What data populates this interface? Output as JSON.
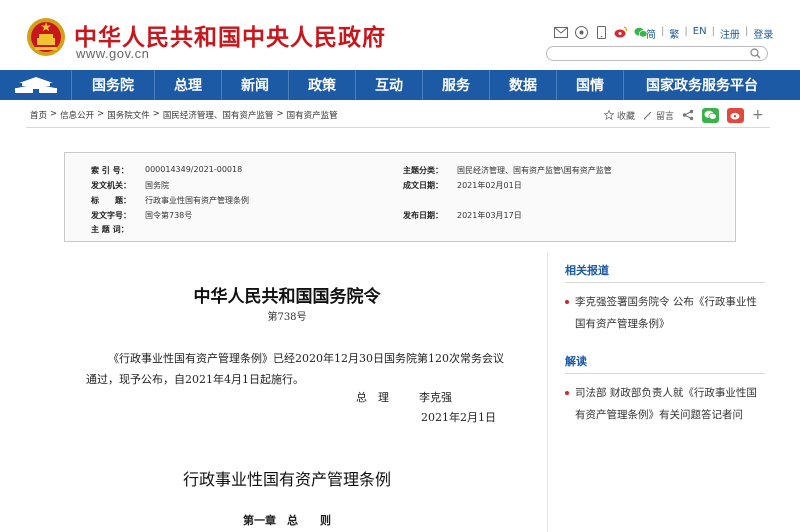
{
  "header": {
    "title": "中华人民共和国中央人民政府",
    "url": "www.gov.cn",
    "lang_links": [
      "简",
      "繁",
      "EN",
      "注册",
      "登录"
    ],
    "search_placeholder": "",
    "icons": [
      "mail-icon",
      "wechat-circle-icon",
      "mobile-icon",
      "weibo-icon",
      "wechat-icon"
    ]
  },
  "nav": {
    "items": [
      "国务院",
      "总理",
      "新闻",
      "政策",
      "互动",
      "服务",
      "数据",
      "国情",
      "国家政务服务平台"
    ]
  },
  "breadcrumb": [
    "首页",
    "信息公开",
    "国务院文件",
    "国民经济管理、国有资产监管",
    "国有资产监管"
  ],
  "tools": {
    "favorite": "收藏",
    "comment": "留言"
  },
  "info": {
    "index_label": "索 引 号：",
    "index_value": "000014349/2021-00018",
    "topic_label": "主题分类：",
    "topic_value": "国民经济管理、国有资产监管\\国有资产监管",
    "issuer_label": "发文机关：",
    "issuer_value": "国务院",
    "created_label": "成文日期：",
    "created_value": "2021年02月01日",
    "title_label": "标　　题：",
    "title_value": "行政事业性国有资产管理条例",
    "docno_label": "发文字号：",
    "docno_value": "国令第738号",
    "publish_label": "发布日期：",
    "publish_value": "2021年03月17日",
    "keywords_label": "主 题 词：",
    "keywords_value": ""
  },
  "article": {
    "order_title": "中华人民共和国国务院令",
    "order_no": "第738号",
    "body": "《行政事业性国有资产管理条例》已经2020年12月30日国务院第120次常务会议通过，现予公布，自2021年4月1日起施行。",
    "signer_role": "总　理",
    "signer_name": "李克强",
    "sign_date": "2021年2月1日",
    "reg_title": "行政事业性国有资产管理条例",
    "chapter": "第一章　总　　则"
  },
  "sidebar": {
    "related_head": "相关报道",
    "related_links": [
      "李克强签署国务院令 公布《行政事业性国有资产管理条例》"
    ],
    "interpret_head": "解读",
    "interpret_links": [
      "司法部 财政部负责人就《行政事业性国有资产管理条例》有关问题答记者问"
    ]
  },
  "colors": {
    "brand_red": "#c8161d",
    "nav_blue": "#1d5aa5"
  }
}
